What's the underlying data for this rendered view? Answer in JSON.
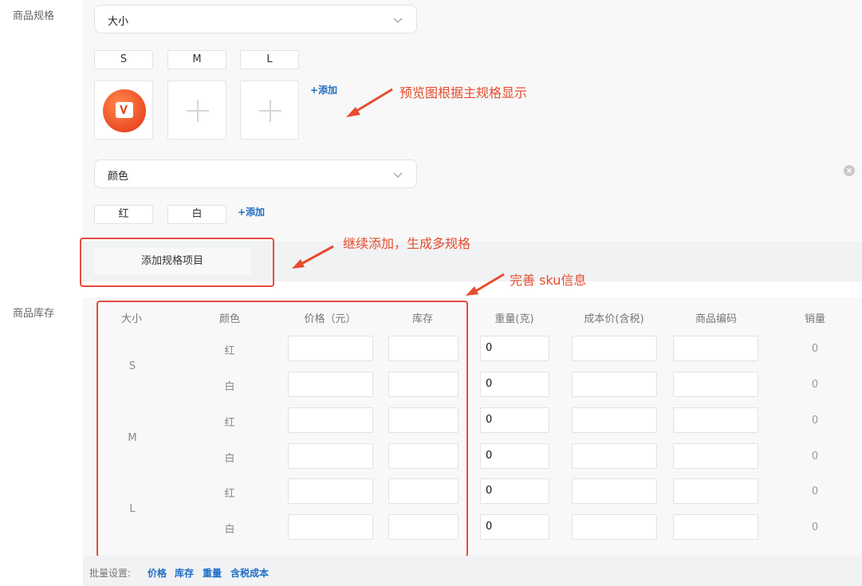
{
  "labels": {
    "spec": "商品规格",
    "stock": "商品库存"
  },
  "spec_group_1": {
    "selected": "大小",
    "values": [
      "S",
      "M",
      "L"
    ],
    "add_label": "+添加"
  },
  "spec_group_2": {
    "selected": "颜色",
    "values": [
      "红",
      "白"
    ],
    "add_label": "+添加"
  },
  "add_spec_button": "添加规格项目",
  "annotations": {
    "preview": "预览图根据主规格显示",
    "continue": "继续添加，生成多规格",
    "sku": "完善 sku信息"
  },
  "table": {
    "headers": [
      "大小",
      "颜色",
      "价格（元）",
      "库存",
      "重量(克)",
      "成本价(含税)",
      "商品编码",
      "销量"
    ],
    "sizes": [
      "S",
      "M",
      "L"
    ],
    "rows": [
      {
        "color": "红",
        "weight": "0",
        "sold": "0"
      },
      {
        "color": "白",
        "weight": "0",
        "sold": "0"
      },
      {
        "color": "红",
        "weight": "0",
        "sold": "0"
      },
      {
        "color": "白",
        "weight": "0",
        "sold": "0"
      },
      {
        "color": "红",
        "weight": "0",
        "sold": "0"
      },
      {
        "color": "白",
        "weight": "0",
        "sold": "0"
      }
    ]
  },
  "batch": {
    "label": "批量设置:",
    "links": [
      "价格",
      "库存",
      "重量",
      "含税成本"
    ]
  },
  "colors": {
    "accent_blue": "#1f6fc5",
    "annotation_red": "#e54d2e",
    "logo_orange": "#f0542d"
  }
}
